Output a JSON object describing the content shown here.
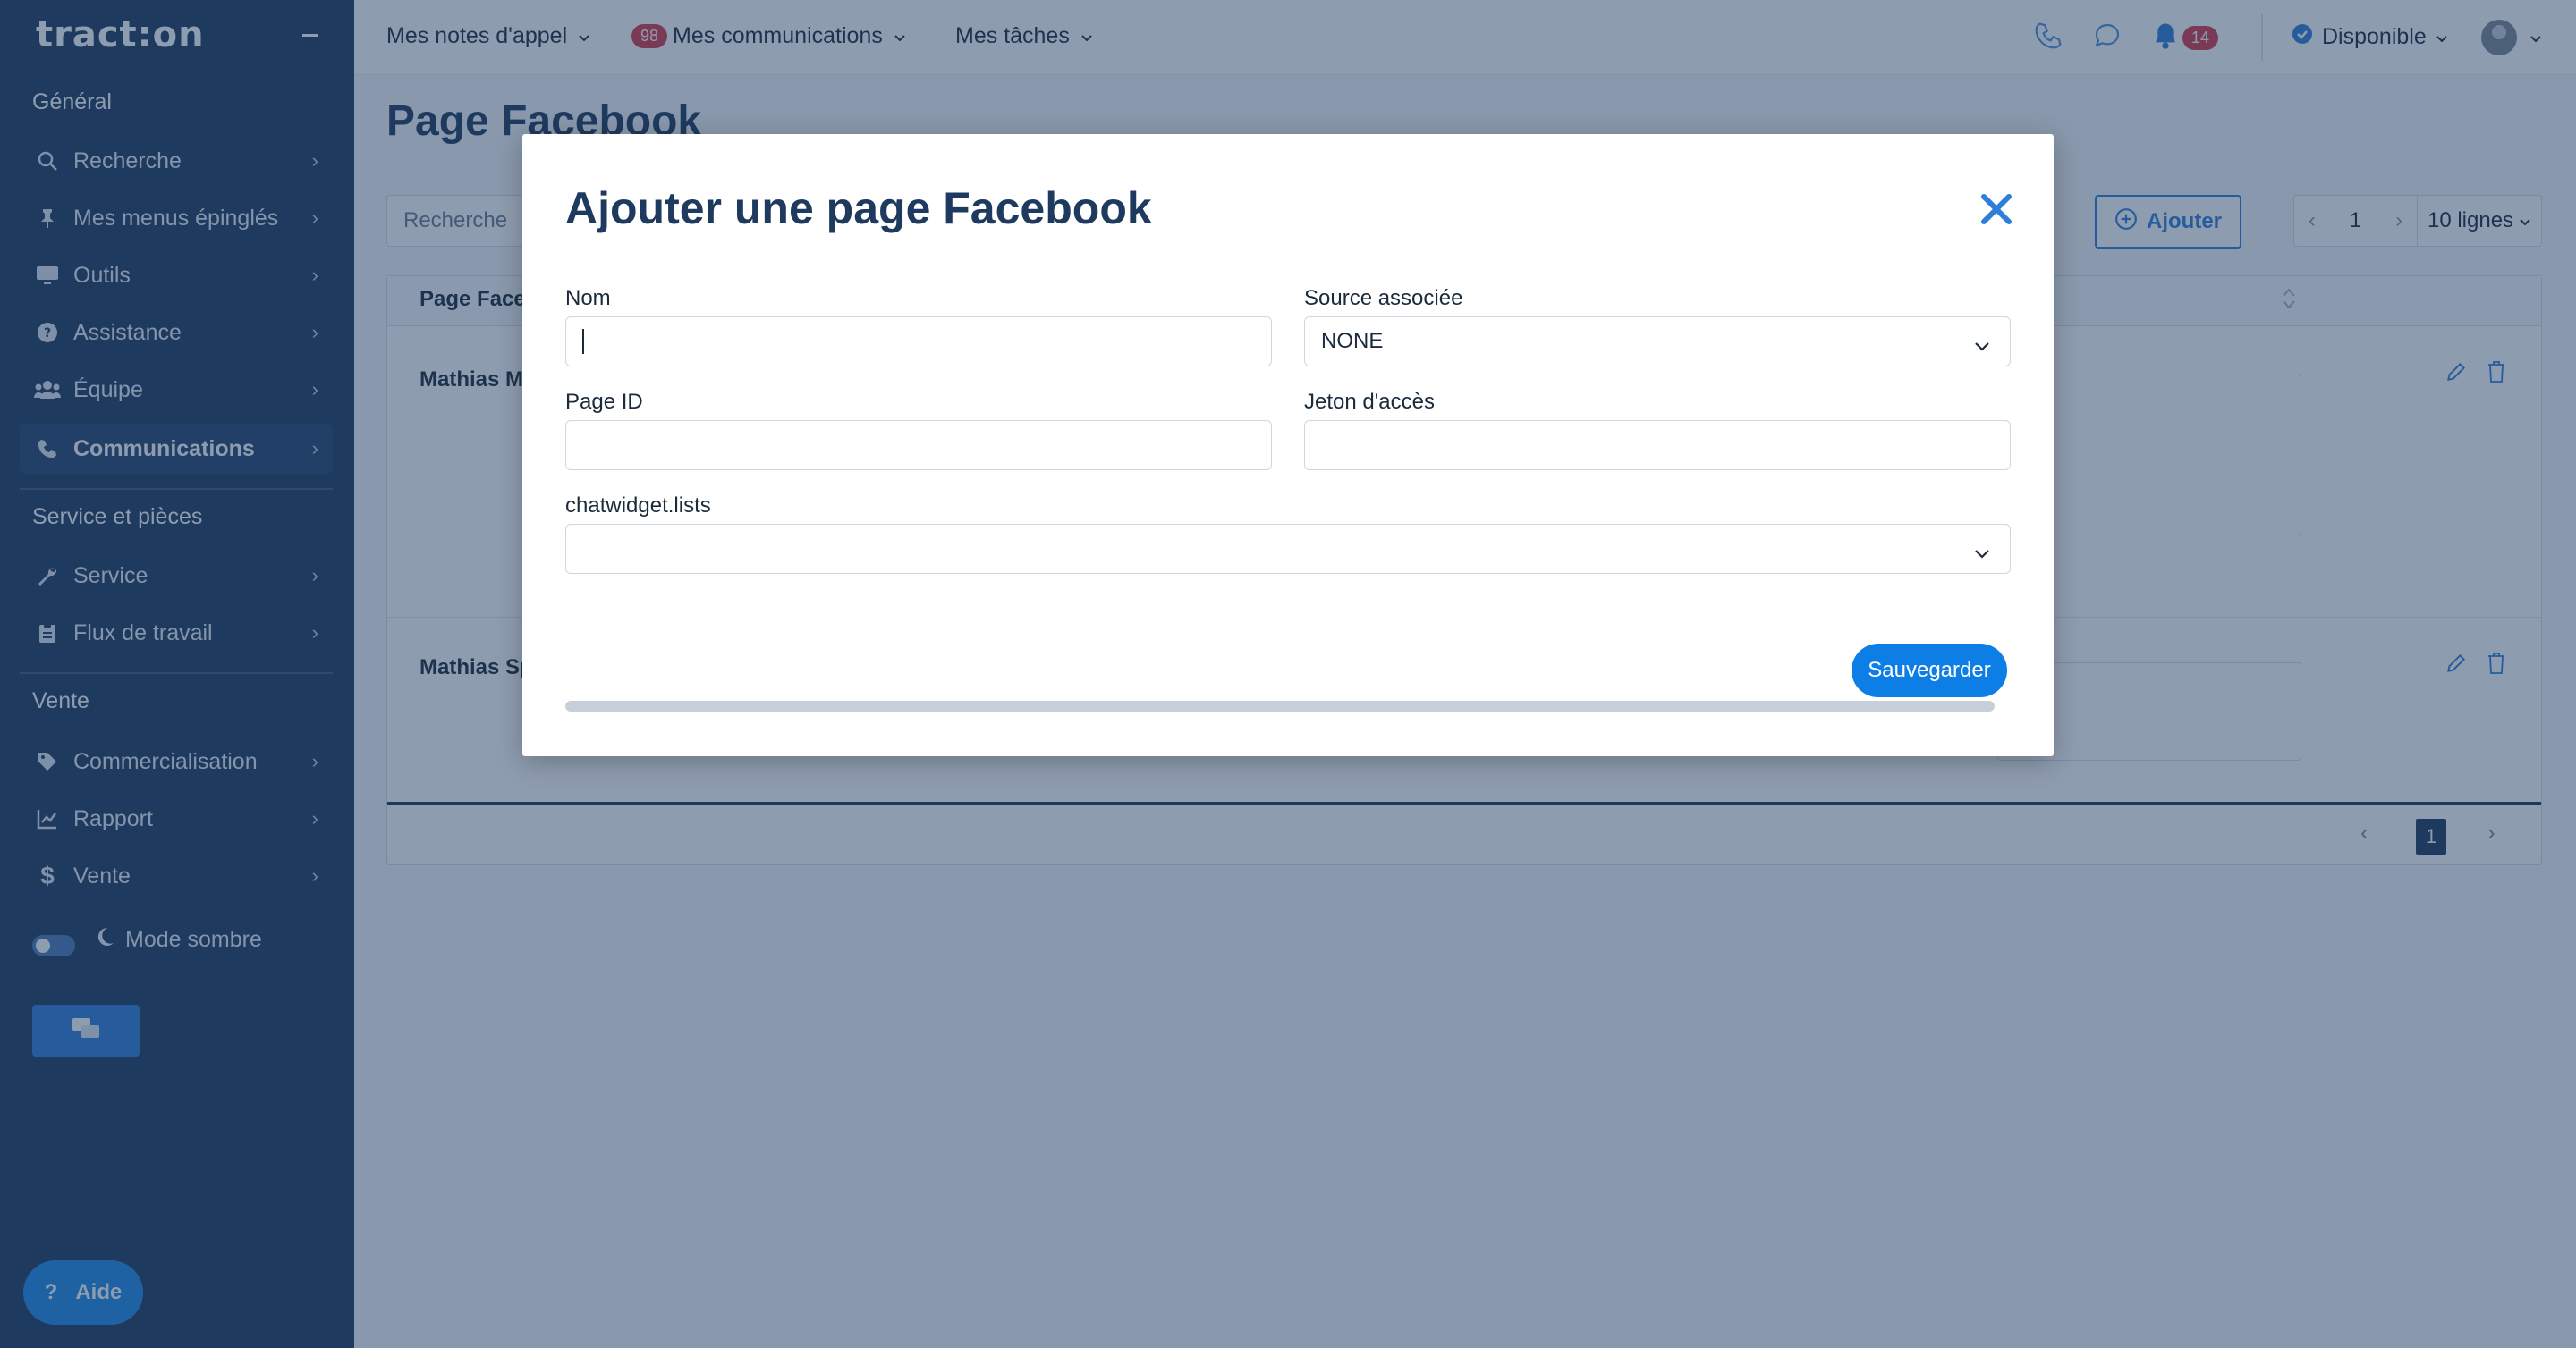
{
  "app": {
    "logo": "tract:on"
  },
  "sidebar": {
    "sections": {
      "general": "Général",
      "service": "Service et pièces",
      "vente": "Vente"
    },
    "items": [
      {
        "label": "Recherche",
        "icon": "search-icon"
      },
      {
        "label": "Mes menus épinglés",
        "icon": "pin-icon"
      },
      {
        "label": "Outils",
        "icon": "monitor-icon"
      },
      {
        "label": "Assistance",
        "icon": "help-circle-icon"
      },
      {
        "label": "Équipe",
        "icon": "users-icon"
      },
      {
        "label": "Communications",
        "icon": "phone-icon",
        "active": true
      },
      {
        "label": "Service",
        "icon": "wrench-icon"
      },
      {
        "label": "Flux de travail",
        "icon": "clipboard-icon"
      },
      {
        "label": "Commercialisation",
        "icon": "tag-icon"
      },
      {
        "label": "Rapport",
        "icon": "chart-line-icon"
      },
      {
        "label": "Vente",
        "icon": "dollar-icon"
      }
    ],
    "dark_mode_label": "Mode sombre",
    "help_label": "Aide"
  },
  "topbar": {
    "call_notes": "Mes notes d'appel",
    "communications": "Mes communications",
    "communications_badge": "98",
    "tasks": "Mes tâches",
    "notifications_badge": "14",
    "status": "Disponible"
  },
  "page": {
    "title": "Page Facebook",
    "search_placeholder": "Recherche",
    "add_label": "Ajouter",
    "pager_page": "1",
    "pager_rows": "10 lignes",
    "column_header": "Page Facebook",
    "rows": [
      {
        "name": "Mathias Ma"
      },
      {
        "name": "Mathias Sp"
      }
    ],
    "footer_page": "1"
  },
  "modal": {
    "title": "Ajouter une page Facebook",
    "fields": {
      "nom_label": "Nom",
      "nom_value": "",
      "source_label": "Source associée",
      "source_value": "NONE",
      "page_id_label": "Page ID",
      "token_label": "Jeton d'accès",
      "lists_label": "chatwidget.lists"
    },
    "save_label": "Sauvegarder",
    "progress": 1.0
  },
  "colors": {
    "sidebar": "#1e3a5f",
    "accent": "#2f7fd8",
    "badge": "#d63a4a",
    "save": "#0d7ee6"
  }
}
